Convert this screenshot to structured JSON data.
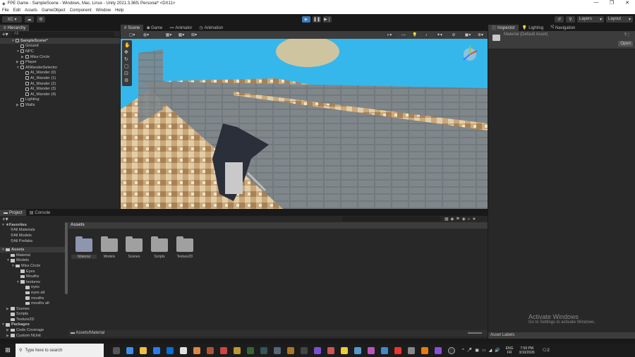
{
  "window": {
    "title": "FPE Game - SampleScene - Windows, Mac, Linux - Unity 2021.3.36f1 Personal* <DX11>",
    "controls": [
      "—",
      "❐",
      "✕"
    ]
  },
  "menu": [
    "File",
    "Edit",
    "Assets",
    "GameObject",
    "Component",
    "Window",
    "Help"
  ],
  "toolbar": {
    "account": "XC ▾",
    "layers": "Layers",
    "layout": "Layout"
  },
  "hierarchy": {
    "tab": "Hierarchy",
    "search_placeholder": "All",
    "items": [
      {
        "label": "SampleScene*",
        "depth": 0,
        "arrow": "▼",
        "scene": true
      },
      {
        "label": "Ground",
        "depth": 1,
        "arrow": ""
      },
      {
        "label": "NPC",
        "depth": 1,
        "arrow": "▼"
      },
      {
        "label": "Miss Circle",
        "depth": 2,
        "arrow": "▶"
      },
      {
        "label": "Player",
        "depth": 1,
        "arrow": "▶"
      },
      {
        "label": "AIWanderSelector",
        "depth": 1,
        "arrow": "▼"
      },
      {
        "label": "AI_Wander (0)",
        "depth": 2,
        "arrow": ""
      },
      {
        "label": "AI_Wander (1)",
        "depth": 2,
        "arrow": ""
      },
      {
        "label": "AI_Wander (2)",
        "depth": 2,
        "arrow": ""
      },
      {
        "label": "AI_Wander (3)",
        "depth": 2,
        "arrow": ""
      },
      {
        "label": "AI_Wander (4)",
        "depth": 2,
        "arrow": ""
      },
      {
        "label": "Lighting",
        "depth": 1,
        "arrow": ""
      },
      {
        "label": "Walls",
        "depth": 1,
        "arrow": "▶"
      }
    ]
  },
  "scene_tabs": [
    "Scene",
    "Game",
    "Animator",
    "Animation"
  ],
  "inspector": {
    "tabs": [
      "Inspector",
      "Lighting",
      "Navigation"
    ],
    "asset_name": "Material (Default Asset)",
    "open_label": "Open",
    "asset_labels": "Asset Labels"
  },
  "project": {
    "tabs": [
      "Project",
      "Console"
    ],
    "favorites_label": "Favorites",
    "favorites": [
      "All Materials",
      "All Models",
      "All Prefabs"
    ],
    "tree": [
      {
        "label": "Assets",
        "depth": 0,
        "arrow": "▼",
        "bold": true
      },
      {
        "label": "Material",
        "depth": 1,
        "arrow": ""
      },
      {
        "label": "Models",
        "depth": 1,
        "arrow": "▼"
      },
      {
        "label": "Miss Circle",
        "depth": 2,
        "arrow": "▼"
      },
      {
        "label": "Eyes",
        "depth": 3,
        "arrow": ""
      },
      {
        "label": "Mouths",
        "depth": 3,
        "arrow": ""
      },
      {
        "label": "textures",
        "depth": 3,
        "arrow": "▼"
      },
      {
        "label": "eyes",
        "depth": 4,
        "arrow": ""
      },
      {
        "label": "eyes alt",
        "depth": 4,
        "arrow": ""
      },
      {
        "label": "mouths",
        "depth": 4,
        "arrow": ""
      },
      {
        "label": "mouths alt",
        "depth": 4,
        "arrow": ""
      },
      {
        "label": "Scenes",
        "depth": 1,
        "arrow": "▶"
      },
      {
        "label": "Scripts",
        "depth": 1,
        "arrow": ""
      },
      {
        "label": "Texture2D",
        "depth": 1,
        "arrow": ""
      },
      {
        "label": "Packages",
        "depth": 0,
        "arrow": "▼",
        "bold": true
      },
      {
        "label": "Code Coverage",
        "depth": 1,
        "arrow": "▶"
      },
      {
        "label": "Custom NUnit",
        "depth": 1,
        "arrow": "▶"
      }
    ],
    "breadcrumb": "Assets",
    "folders": [
      "Material",
      "Models",
      "Scenes",
      "Scripts",
      "Texture2D"
    ],
    "selected_path": "Assets/Material"
  },
  "watermark": {
    "title": "Activate Windows",
    "subtitle": "Go to Settings to activate Windows."
  },
  "taskbar": {
    "search_placeholder": "Type here to search",
    "lang": "ENG",
    "region": "FR",
    "time": "7:59 PM",
    "date": "3/10/2026",
    "notifications": "2"
  },
  "colors": {
    "sky": "#35b7ec",
    "accent": "#3a79bb"
  }
}
